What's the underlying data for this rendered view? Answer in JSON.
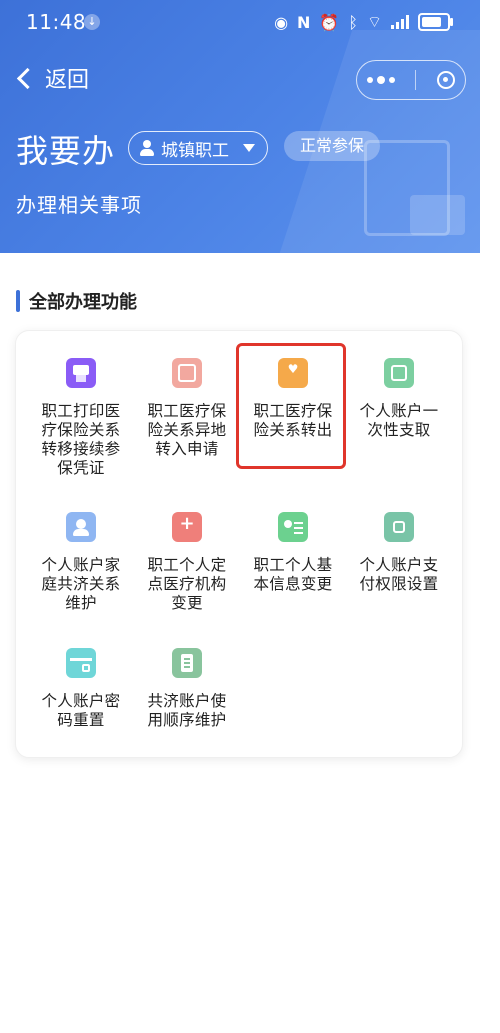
{
  "status_bar": {
    "time": "11:48"
  },
  "nav": {
    "back_label": "返回"
  },
  "header": {
    "title": "我要办",
    "category": "城镇职工",
    "status_badge": "正常参保",
    "subtitle": "办理相关事项"
  },
  "section": {
    "title": "全部办理功能"
  },
  "functions": [
    {
      "label": "职工打印医疗保险关系转移接续参保凭证",
      "icon": "printer-icon"
    },
    {
      "label": "职工医疗保险关系异地转入申请",
      "icon": "transfer-in-icon"
    },
    {
      "label": "职工医疗保险关系转出",
      "icon": "transfer-out-icon",
      "highlighted": true
    },
    {
      "label": "个人账户一次性支取",
      "icon": "withdraw-icon"
    },
    {
      "label": "个人账户家庭共济关系维护",
      "icon": "family-icon"
    },
    {
      "label": "职工个人定点医疗机构变更",
      "icon": "hospital-icon"
    },
    {
      "label": "职工个人基本信息变更",
      "icon": "profile-card-icon"
    },
    {
      "label": "个人账户支付权限设置",
      "icon": "permission-icon"
    },
    {
      "label": "个人账户密码重置",
      "icon": "card-lock-icon"
    },
    {
      "label": "共济账户使用顺序维护",
      "icon": "document-icon"
    }
  ],
  "colors": {
    "header_blue": "#3d71d8",
    "highlight_red": "#e0352b"
  }
}
